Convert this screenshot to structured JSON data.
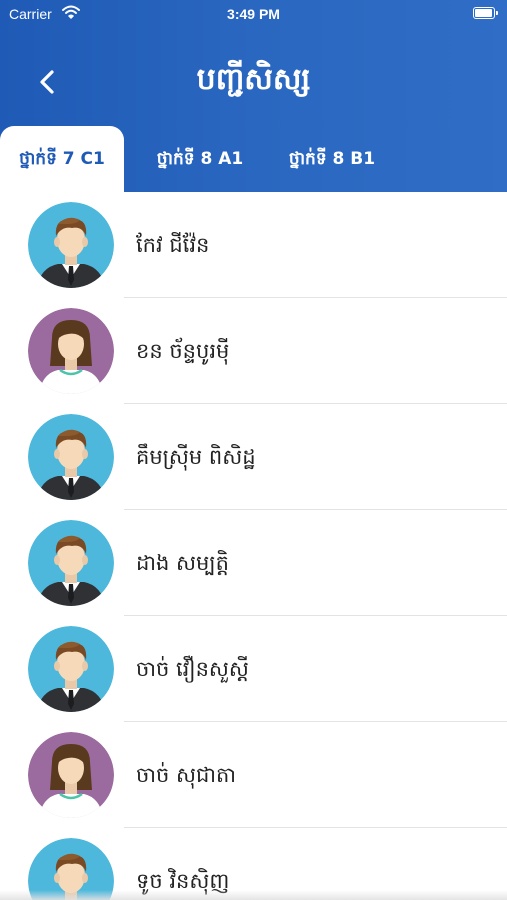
{
  "status_bar": {
    "carrier": "Carrier",
    "time": "3:49 PM"
  },
  "header": {
    "title": "បញ្ជីសិស្ស",
    "back_icon": "chevron-left-icon"
  },
  "tabs": [
    {
      "label": "ថ្នាក់ទី 7 C1",
      "active": true
    },
    {
      "label": "ថ្នាក់ទី 8 A1",
      "active": false
    },
    {
      "label": "ថ្នាក់ទី 8 B1",
      "active": false
    }
  ],
  "students": [
    {
      "name": "កែវ ជីវ៉ែន",
      "avatar": "male-avatar"
    },
    {
      "name": "ខន ច័ន្ទបូរមុី",
      "avatar": "female-avatar"
    },
    {
      "name": "គឹមស្រ៊ីម ពិសិដ្ឋ",
      "avatar": "male-avatar"
    },
    {
      "name": "ដាង សម្បត្តិ",
      "avatar": "male-avatar"
    },
    {
      "name": "ចាច់ វឿនសួស្ដី",
      "avatar": "male-avatar"
    },
    {
      "name": "ចាច់ សុជាតា",
      "avatar": "female-avatar"
    },
    {
      "name": "ទូច វិនស៊ិញ",
      "avatar": "male-avatar"
    }
  ],
  "colors": {
    "header_blue": "#1f5bb6",
    "male_avatar_bg": "#4db8dc",
    "female_avatar_bg": "#9b6a9e"
  }
}
